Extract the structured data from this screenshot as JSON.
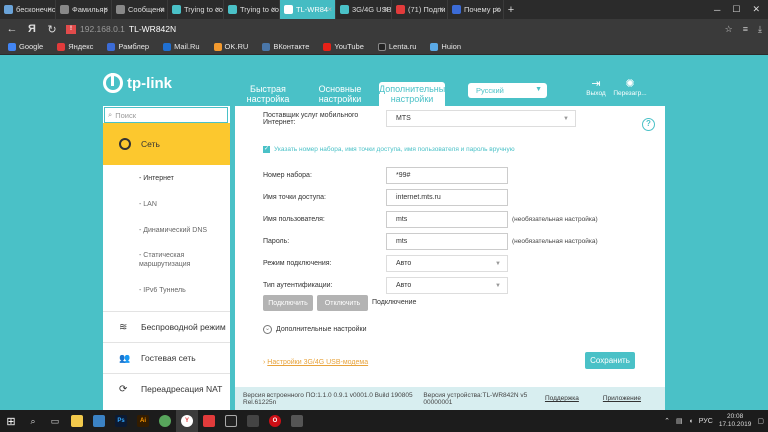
{
  "browser": {
    "tabs": [
      {
        "label": "бесконечно",
        "color": "#6aa3d8"
      },
      {
        "label": "Фамильяр",
        "color": "#888888"
      },
      {
        "label": "Сообщени",
        "color": "#888888"
      },
      {
        "label": "Trying to co",
        "color": "#4ac1c7"
      },
      {
        "label": "Trying to co",
        "color": "#4ac1c7"
      },
      {
        "label": "TL-WR84",
        "color": "#4ac1c7",
        "active": true
      },
      {
        "label": "3G/4G USB",
        "color": "#4ac1c7"
      },
      {
        "label": "(71) Подпи",
        "color": "#e23b3b"
      },
      {
        "label": "Почему ро",
        "color": "#3b6bd6"
      }
    ],
    "address": {
      "host": "192.168.0.1",
      "title": "TL-WR842N"
    },
    "bookmarks": [
      {
        "label": "Google",
        "color": "#4285f4"
      },
      {
        "label": "Яндекс",
        "color": "#e23b3b"
      },
      {
        "label": "Рамблер",
        "color": "#3b6bd6"
      },
      {
        "label": "Mail.Ru",
        "color": "#1f6fd1"
      },
      {
        "label": "OK.RU",
        "color": "#f2992e"
      },
      {
        "label": "ВКонтакте",
        "color": "#4a76a8"
      },
      {
        "label": "YouTube",
        "color": "#e62117"
      },
      {
        "label": "Lenta.ru",
        "color": "#222222"
      },
      {
        "label": "Huion",
        "color": "#5aa9e6"
      }
    ]
  },
  "header": {
    "logo": "tp-link",
    "nav": [
      {
        "label": "Быстрая настройка"
      },
      {
        "label": "Основные настройки"
      },
      {
        "label": "Дополнительные настройки",
        "active": true
      }
    ],
    "language": "Русский",
    "logout": "Выход",
    "reboot": "Перезагр..."
  },
  "sidebar": {
    "search_placeholder": "Поиск",
    "network": "Сеть",
    "subitems": [
      "- Интернет",
      "- LAN",
      "- Динамический DNS",
      "- Статическая маршрутизация",
      "- IPv6 Туннель"
    ],
    "wireless": "Беспроводной режим",
    "guest": "Гостевая сеть",
    "nat": "Переадресация NAT"
  },
  "form": {
    "provider_label": "Поставщик услуг мобильного Интернет:",
    "provider_value": "MTS",
    "manual_check": "Указать номер набора, имя точки доступа, имя пользователя и пароль вручную",
    "dial_label": "Номер набора:",
    "dial_value": "*99#",
    "apn_label": "Имя точки доступа:",
    "apn_value": "internet.mts.ru",
    "user_label": "Имя пользователя:",
    "user_value": "mts",
    "user_note": "(необязательная настройка)",
    "pass_label": "Пароль:",
    "pass_value": "mts",
    "pass_note": "(необязательная настройка)",
    "mode_label": "Режим подключения:",
    "mode_value": "Авто",
    "auth_label": "Тип аутентификации:",
    "auth_value": "Авто",
    "connect": "Подключить",
    "disconnect": "Отключить",
    "status": "Подключение",
    "advanced": "Дополнительные настройки",
    "usb_link": "Настройки 3G/4G USB-модема",
    "save": "Сохранить"
  },
  "footer": {
    "firmware": "Версия встроенного ПО:1.1.0 0.9.1 v0001.0 Build 190805 Rel.61225n",
    "hardware": "Версия устройства:TL-WR842N v5 00000001",
    "support": "Поддержка",
    "app": "Приложение"
  },
  "taskbar": {
    "lang": "РУС",
    "time": "20:08",
    "date": "17.10.2019"
  }
}
